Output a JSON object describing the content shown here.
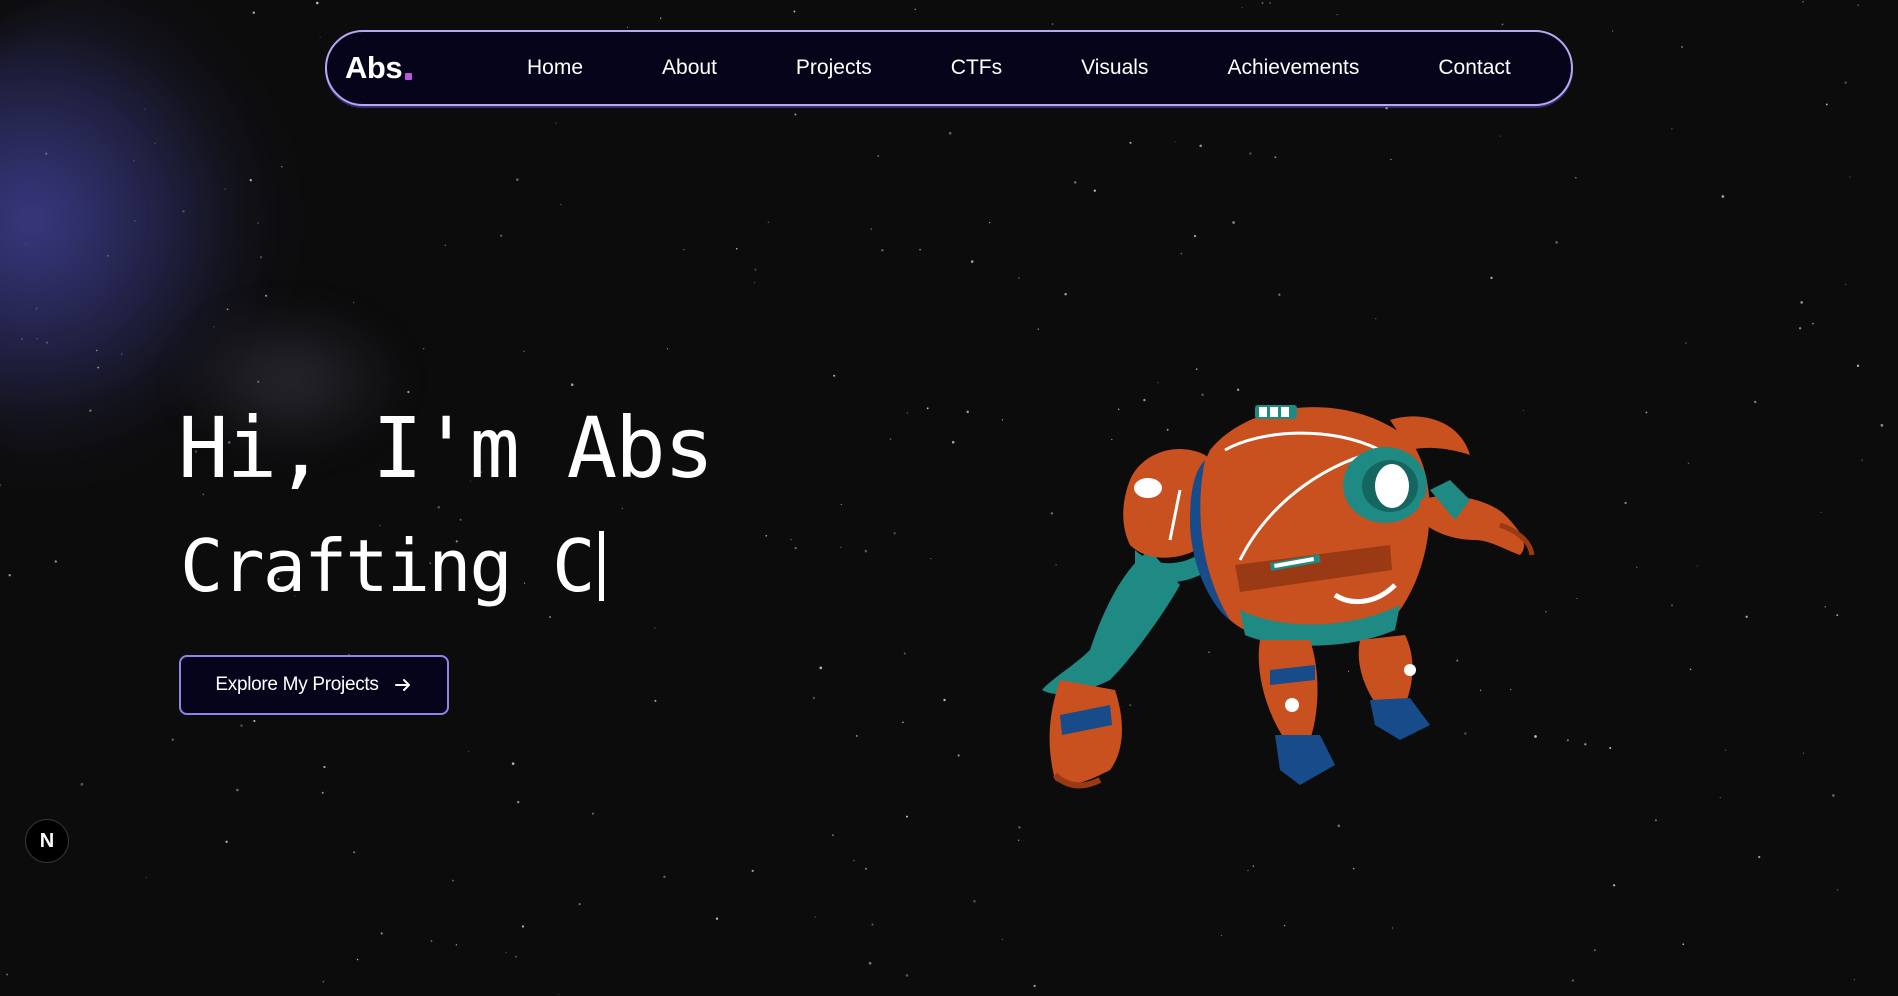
{
  "nav": {
    "logo_text": "Abs",
    "logo_dot_color": "#b65ad9",
    "links": [
      {
        "label": "Home"
      },
      {
        "label": "About"
      },
      {
        "label": "Projects"
      },
      {
        "label": "CTFs"
      },
      {
        "label": "Visuals"
      },
      {
        "label": "Achievements"
      },
      {
        "label": "Contact"
      }
    ]
  },
  "hero": {
    "title": "Hi, I'm Abs",
    "subtitle_typed": "Crafting C",
    "cta_label": "Explore My Projects",
    "cta_icon": "arrow-right-icon"
  },
  "badge": {
    "letter": "N",
    "icon": "nextjs-icon"
  },
  "colors": {
    "background": "#0c0c0d",
    "nav_border": "#b9a8f0",
    "nav_bg": "#05041a",
    "cta_border": "#8d86e6",
    "robot_orange": "#c9501f",
    "robot_teal": "#1f8a84",
    "robot_blue": "#184b8a"
  }
}
